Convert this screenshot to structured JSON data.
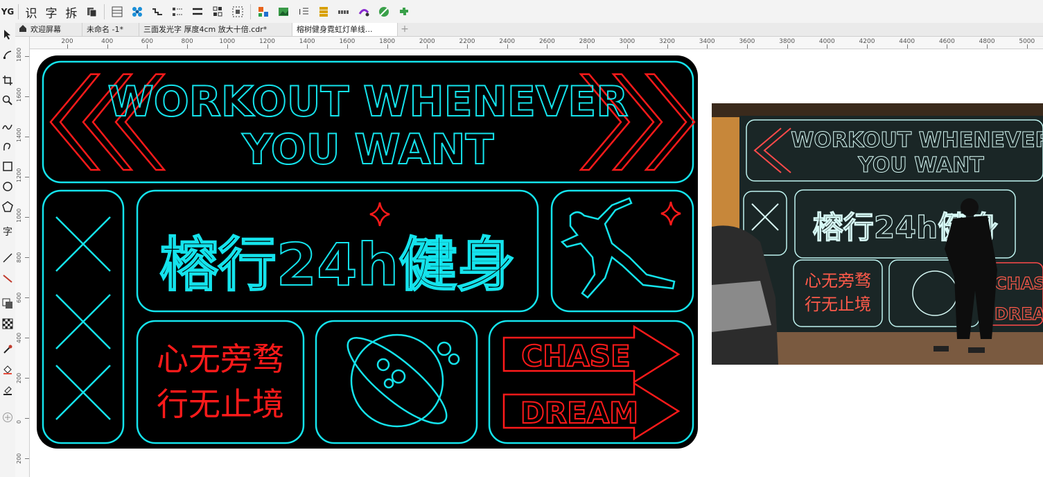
{
  "toolbar": {
    "brand_text": "YG",
    "labels": [
      "识",
      "字",
      "拆"
    ],
    "icons": [
      "layers-icon",
      "table-icon",
      "network-icon",
      "wave-icon",
      "dots-icon",
      "lines-icon",
      "grid-icon",
      "select-icon",
      "shapes-icon",
      "image-icon",
      "text-align-icon",
      "list-icon",
      "row-icon",
      "color-icon",
      "pen-icon",
      "puzzle-icon"
    ]
  },
  "tabs": [
    {
      "label": "欢迎屏幕",
      "icon": "home-icon"
    },
    {
      "label": "未命名 -1*"
    },
    {
      "label": "三面发光字 厚度4cm 放大十倍.cdr*"
    },
    {
      "label": "榕树健身霓虹灯单线..."
    }
  ],
  "hruler_ticks": [
    "200",
    "400",
    "600",
    "800",
    "1000",
    "1200",
    "1400",
    "1600",
    "1800",
    "2000",
    "2200",
    "2400",
    "2600",
    "2800",
    "3000",
    "3200",
    "3400",
    "3600",
    "3800",
    "4000",
    "4200",
    "4400",
    "4600",
    "4800",
    "5000"
  ],
  "vruler_ticks": [
    "1800",
    "1600",
    "1400",
    "1200",
    "1000",
    "800",
    "600",
    "400",
    "200",
    "0",
    "200"
  ],
  "left_tools": [
    "pointer-icon",
    "node-icon",
    "crop-icon",
    "zoom-icon",
    "freehand-icon",
    "curve-icon",
    "rectangle-icon",
    "ellipse-icon",
    "polygon-icon",
    "text-tool-icon",
    "line-icon",
    "connector-icon",
    "shadow-icon",
    "pattern-icon",
    "eyedropper-icon",
    "fill-icon",
    "outline-icon",
    "add-icon"
  ],
  "design": {
    "headline_1": "WORKOUT WHENEVER",
    "headline_2": "YOU WANT",
    "brand": "榕行24h健身",
    "slogan_1": "心无旁骛",
    "slogan_2": "行无止境",
    "arrow_1": "CHASE",
    "arrow_2": "DREAM"
  },
  "photo": {
    "headline_1": "WORKOUT WHENEVER",
    "headline_2": "YOU WANT",
    "brand": "榕行24h健身",
    "slogan_1": "心无旁骛",
    "slogan_2": "行无止境",
    "arrow_1": "CHAS",
    "arrow_2": "DREA"
  },
  "colors": {
    "cyan": "#14e3ec",
    "red": "#ff1a1a",
    "sign_bg": "#000000"
  }
}
